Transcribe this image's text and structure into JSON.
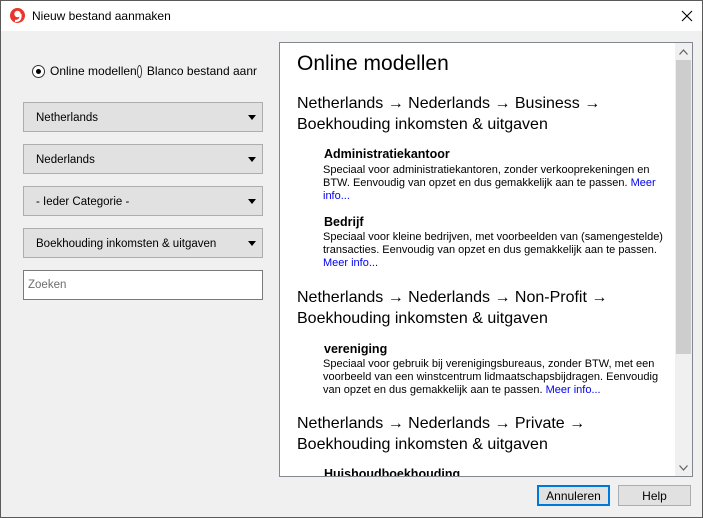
{
  "window": {
    "title": "Nieuw bestand aanmaken"
  },
  "source": {
    "online_label": "Online modellen",
    "blank_label": "Blanco bestand aanr",
    "selected": "online"
  },
  "filters": {
    "country": "Netherlands",
    "language": "Nederlands",
    "category": "- Ieder Categorie -",
    "type": "Boekhouding inkomsten & uitgaven"
  },
  "search": {
    "placeholder": "Zoeken"
  },
  "panel": {
    "heading": "Online modellen",
    "groups": [
      {
        "path": "Netherlands → Nederlands → Business → Boekhouding inkomsten & uitgaven",
        "models": [
          {
            "name": "Administratiekantoor",
            "description": "Speciaal voor administratiekantoren, zonder verkooprekeningen en BTW. Eenvoudig van opzet en dus gemakkelijk aan te passen.",
            "link": "Meer info..."
          },
          {
            "name": "Bedrijf",
            "description": "Speciaal voor kleine bedrijven, met voorbeelden van (samengestelde) transacties. Eenvoudig van opzet en dus gemakkelijk aan te passen.",
            "link": "Meer info..."
          }
        ]
      },
      {
        "path": "Netherlands → Nederlands → Non-Profit → Boekhouding inkomsten & uitgaven",
        "models": [
          {
            "name": "vereniging",
            "description": "Speciaal voor gebruik bij verenigingsbureaus, zonder BTW, met een voorbeeld van een winstcentrum lidmaatschapsbijdragen. Eenvoudig van opzet en dus gemakkelijk aan te passen.",
            "link": "Meer info..."
          }
        ]
      },
      {
        "path": "Netherlands → Nederlands → Private → Boekhouding inkomsten & uitgaven",
        "models": [
          {
            "name": "Huishoudboekhouding"
          }
        ]
      }
    ]
  },
  "buttons": {
    "cancel": "Annuleren",
    "help": "Help"
  },
  "colors": {
    "accent": "#0078d7",
    "link": "#0000ee",
    "app_icon": "#e8342b"
  }
}
